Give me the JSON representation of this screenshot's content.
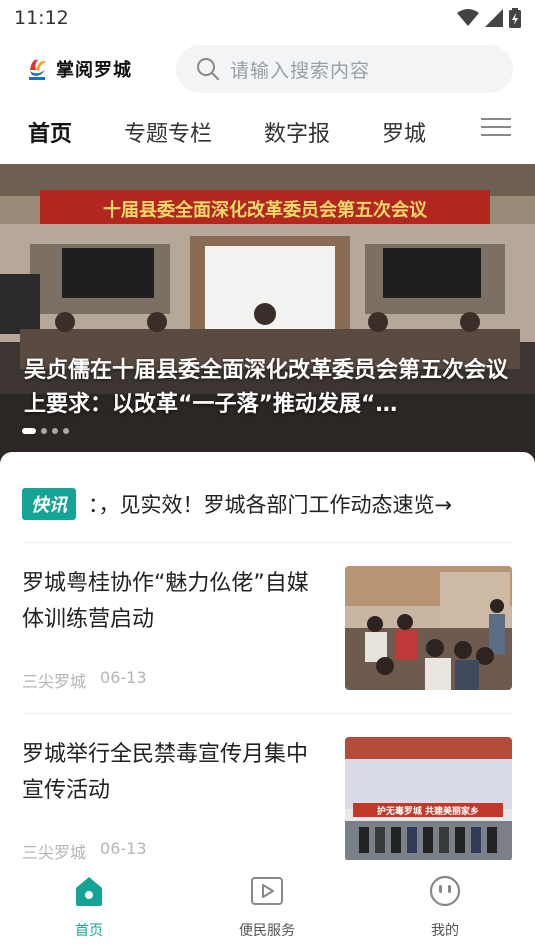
{
  "status_bar": {
    "time": "11:12"
  },
  "header": {
    "app_name": "掌阅罗城",
    "search_placeholder": "请输入搜索内容"
  },
  "nav_tabs": [
    {
      "label": "首页",
      "active": true
    },
    {
      "label": "专题专栏",
      "active": false
    },
    {
      "label": "数字报",
      "active": false
    },
    {
      "label": "罗城",
      "active": false
    }
  ],
  "hero": {
    "banner_text": "十届县委全面深化改革委员会第五次会议",
    "title": "吴贞儒在十届县委全面深化改革委员会第五次会议上要求：以改革“一子落”推动发展“…",
    "slide_count": 4,
    "active_slide": 1
  },
  "flash": {
    "badge": "快讯",
    "text": "：，见实效！罗城各部门工作动态速览→"
  },
  "news": [
    {
      "title": "罗城粤桂协作“魅力仫佬”自媒体训练营启动",
      "source": "三尖罗城",
      "date": "06-13"
    },
    {
      "title": "罗城举行全民禁毒宣传月集中宣传活动",
      "source": "三尖罗城",
      "date": "06-13",
      "image_text": "护无毒罗城 共建美丽家乡"
    }
  ],
  "bottom_nav": [
    {
      "label": "首页",
      "icon": "home-icon",
      "active": true
    },
    {
      "label": "便民服务",
      "icon": "play-icon",
      "active": false
    },
    {
      "label": "我的",
      "icon": "face-icon",
      "active": false
    }
  ],
  "colors": {
    "accent": "#14a394",
    "search_bg": "#f2f4f6",
    "meta_text": "#b5b5b5"
  }
}
